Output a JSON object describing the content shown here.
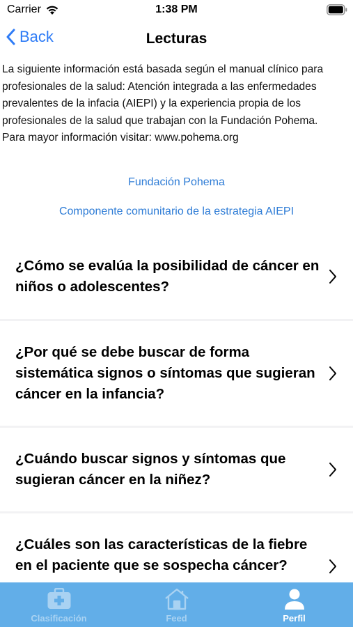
{
  "status_bar": {
    "carrier": "Carrier",
    "time": "1:38 PM",
    "icons": [
      "wifi-icon",
      "battery-icon"
    ]
  },
  "nav": {
    "back_label": "Back",
    "title": "Lecturas"
  },
  "intro": {
    "paragraph": "La siguiente información está basada según el manual clínico para profesionales de la salud: Atención integrada a las enfermedades prevalentes de la infacia (AIEPI) y la experiencia propia de los profesionales de la salud que trabajan con la Fundación Pohema.",
    "more_info": "Para mayor información visitar: www.pohema.org"
  },
  "links": {
    "fundacion": "Fundación Pohema",
    "componente": "Componente comunitario de la estrategia AIEPI"
  },
  "questions": [
    {
      "label": "¿Cómo se evalúa la posibilidad de cáncer en niños o adolescentes?"
    },
    {
      "label": "¿Por qué se debe buscar de forma sistemática signos o síntomas que sugieran cáncer en la infancia?"
    },
    {
      "label": "¿Cuándo buscar signos y síntomas que sugieran cáncer en la niñez?"
    },
    {
      "label": "¿Cuáles son las características de la fiebre en el paciente que se sospecha cáncer?"
    }
  ],
  "tabs": [
    {
      "label": "Clasificación",
      "icon": "medical-kit-icon",
      "active": false
    },
    {
      "label": "Feed",
      "icon": "home-icon",
      "active": false
    },
    {
      "label": "Perfil",
      "icon": "person-icon",
      "active": true
    }
  ],
  "colors": {
    "accent": "#2f7cf6",
    "link": "#2e7cd6",
    "tab_bar": "#62aee8",
    "separator": "#f2f2f4"
  }
}
